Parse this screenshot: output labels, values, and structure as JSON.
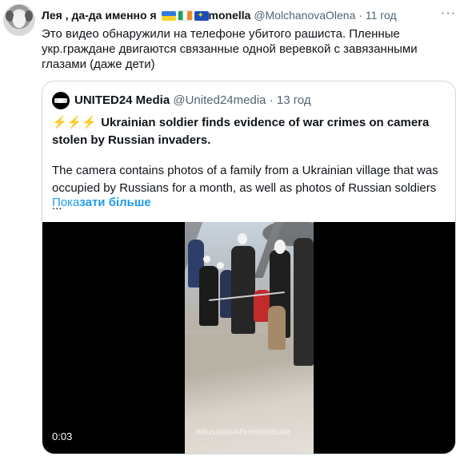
{
  "tweet": {
    "author_name": "Лея , да-да именно я",
    "name_suffix": "monella",
    "handle": "@MolchanovaOlena",
    "time": "11 год",
    "more_icon": "more-horizontal-icon",
    "text": "Это видео обнаружили на телефоне убитого рашиста. Пленные укр.граждане двигаются связанные одной веревкой с завязанными глазами (даже дети)"
  },
  "quote": {
    "author_name": "UNITED24 Media",
    "handle": "@United24media",
    "time": "13 год",
    "title_icons": "⚡⚡⚡",
    "title": "Ukrainian soldier finds evidence of war crimes on camera stolen by Russian invaders.",
    "description": "The camera contains photos of a family from a Ukrainian village that was occupied by Russians for a month, as well as photos of Russian soldiers ...",
    "show_more_prefix": "Пока",
    "show_more_bold": "зати більше",
    "video": {
      "duration": "0:03",
      "watermark": "#RussiaIsATerroristState"
    }
  },
  "colors": {
    "link": "#1d9bf0",
    "secondary_text": "#536471",
    "border": "#cfd9de"
  }
}
